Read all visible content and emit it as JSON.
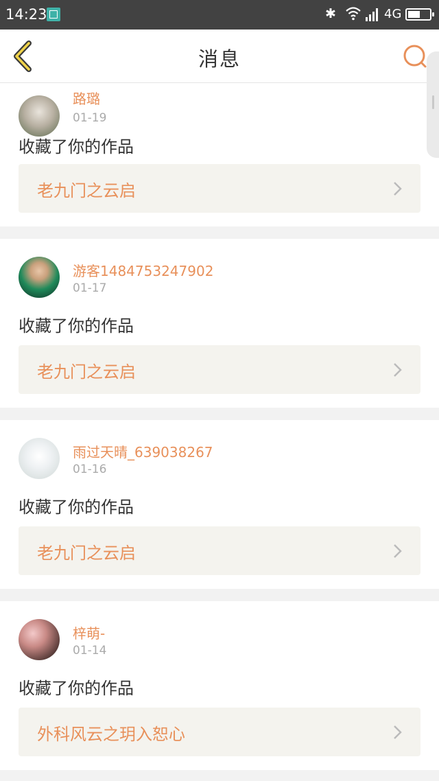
{
  "status_bar": {
    "time": "14:23",
    "network": "4G",
    "battery_level": 0.55,
    "icons": [
      "screenshot-icon",
      "bluetooth-icon",
      "wifi-icon",
      "signal-icon",
      "battery-icon"
    ]
  },
  "navbar": {
    "title": "消息",
    "back_icon": "chevron-left-icon",
    "search_icon": "search-icon",
    "accent_color": "#e8905a"
  },
  "notifications": [
    {
      "user": "路璐",
      "date": "01-19",
      "action": "收藏了你的作品",
      "work": "老九门之云启"
    },
    {
      "user": "游客1484753247902",
      "date": "01-17",
      "action": "收藏了你的作品",
      "work": "老九门之云启"
    },
    {
      "user": "雨过天晴_639038267",
      "date": "01-16",
      "action": "收藏了你的作品",
      "work": "老九门之云启"
    },
    {
      "user": "梓萌-",
      "date": "01-14",
      "action": "收藏了你的作品",
      "work": "外科风云之玥入恕心"
    }
  ]
}
